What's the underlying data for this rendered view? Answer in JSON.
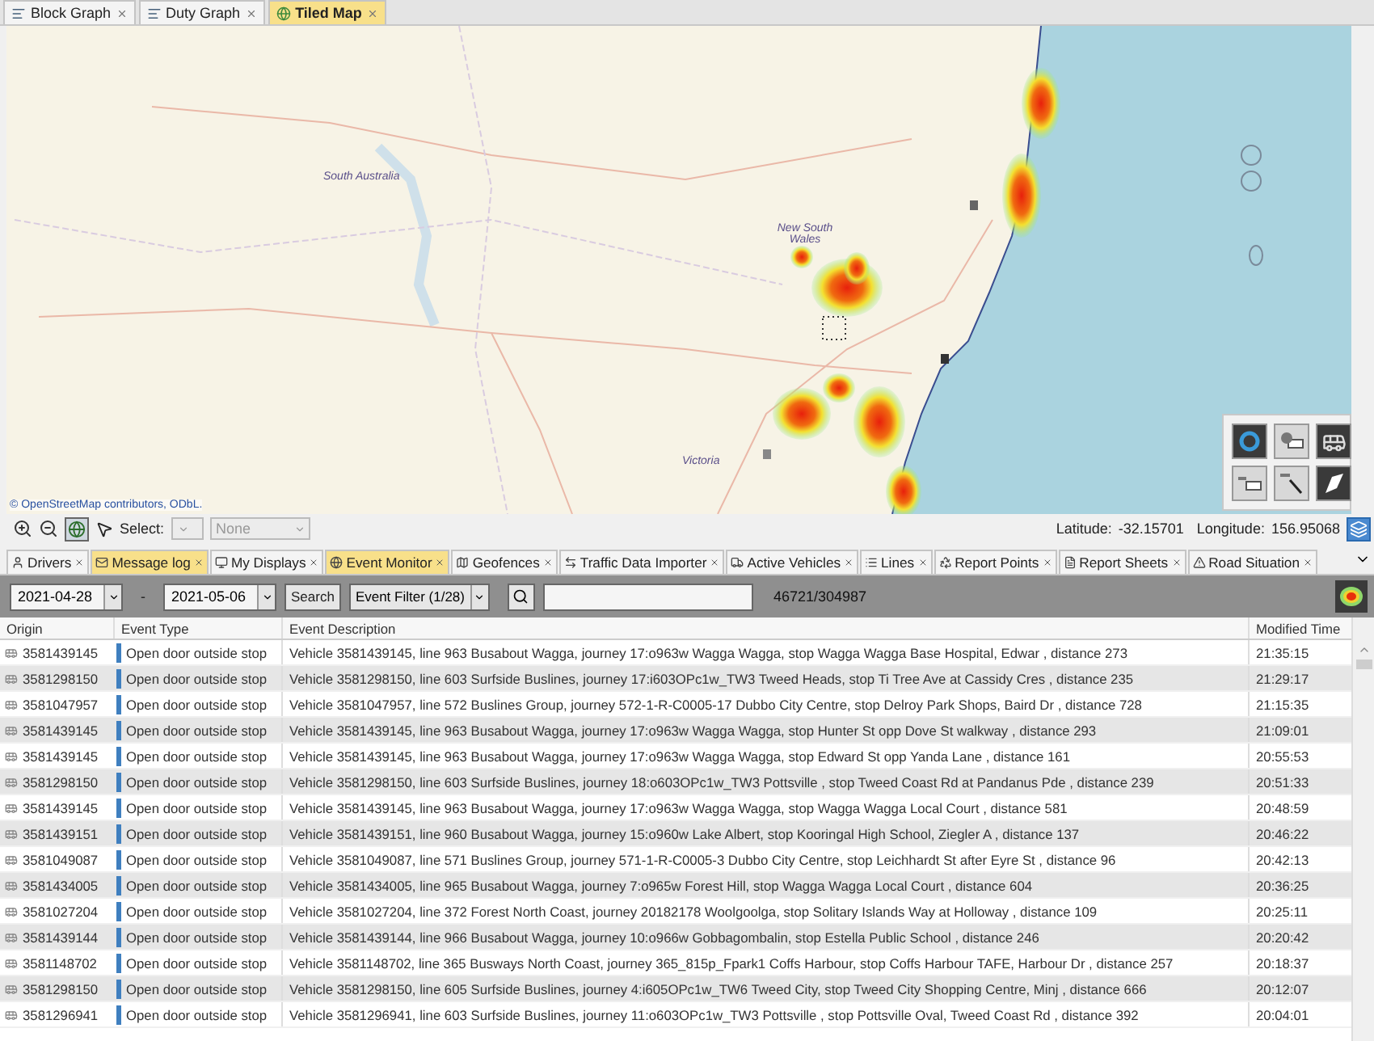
{
  "top_tabs": [
    {
      "label": "Block Graph",
      "selected": false
    },
    {
      "label": "Duty Graph",
      "selected": false
    },
    {
      "label": "Tiled Map",
      "selected": true
    }
  ],
  "map": {
    "labels": [
      "South Australia",
      "New South Wales",
      "Victoria"
    ],
    "attribution": "© OpenStreetMap contributors, ODbL.",
    "tools": [
      {
        "kind": "ring",
        "active": true
      },
      {
        "kind": "point",
        "active": false
      },
      {
        "kind": "bus",
        "active": true
      },
      {
        "kind": "box",
        "active": false
      },
      {
        "kind": "pen",
        "active": false
      },
      {
        "kind": "polygon",
        "active": true
      }
    ]
  },
  "map_toolbar": {
    "select_label": "Select:",
    "select_value": "None",
    "latitude_label": "Latitude:",
    "latitude": "-32.15701",
    "longitude_label": "Longitude:",
    "longitude": "156.95068"
  },
  "bottom_tabs": [
    {
      "label": "Drivers",
      "selected": false
    },
    {
      "label": "Message log",
      "selected": true
    },
    {
      "label": "My Displays",
      "selected": false
    },
    {
      "label": "Event Monitor",
      "selected": true
    },
    {
      "label": "Geofences",
      "selected": false
    },
    {
      "label": "Traffic Data Importer",
      "selected": false
    },
    {
      "label": "Active Vehicles",
      "selected": false
    },
    {
      "label": "Lines",
      "selected": false
    },
    {
      "label": "Report Points",
      "selected": false
    },
    {
      "label": "Report Sheets",
      "selected": false
    },
    {
      "label": "Road Situation",
      "selected": false
    }
  ],
  "filter_bar": {
    "date_from": "2021-04-28",
    "date_separator": "-",
    "date_to": "2021-05-06",
    "search_button": "Search",
    "event_filter": "Event Filter (1/28)",
    "count": "46721/304987"
  },
  "table": {
    "columns": [
      "Origin",
      "Event Type",
      "Event Description",
      "Modified Time"
    ],
    "rows": [
      {
        "origin": "3581439145",
        "event_type": "Open door outside stop",
        "description": "Vehicle 3581439145, line 963 Busabout Wagga, journey 17:o963w Wagga Wagga, stop Wagga Wagga Base Hospital, Edwar , distance 273",
        "time": "21:35:15"
      },
      {
        "origin": "3581298150",
        "event_type": "Open door outside stop",
        "description": "Vehicle 3581298150, line 603 Surfside Buslines, journey 17:i603OPc1w_TW3 Tweed Heads, stop Ti Tree Ave at Cassidy Cres , distance 235",
        "time": "21:29:17"
      },
      {
        "origin": "3581047957",
        "event_type": "Open door outside stop",
        "description": "Vehicle 3581047957, line 572 Buslines Group, journey 572-1-R-C0005-17 Dubbo City Centre, stop Delroy Park Shops, Baird Dr , distance 728",
        "time": "21:15:35"
      },
      {
        "origin": "3581439145",
        "event_type": "Open door outside stop",
        "description": "Vehicle 3581439145, line 963 Busabout Wagga, journey 17:o963w Wagga Wagga, stop Hunter St opp Dove St walkway , distance 293",
        "time": "21:09:01"
      },
      {
        "origin": "3581439145",
        "event_type": "Open door outside stop",
        "description": "Vehicle 3581439145, line 963 Busabout Wagga, journey 17:o963w Wagga Wagga, stop Edward St opp Yanda Lane , distance 161",
        "time": "20:55:53"
      },
      {
        "origin": "3581298150",
        "event_type": "Open door outside stop",
        "description": "Vehicle 3581298150, line 603 Surfside Buslines, journey 18:o603OPc1w_TW3 Pottsville , stop Tweed Coast Rd at Pandanus Pde , distance 239",
        "time": "20:51:33"
      },
      {
        "origin": "3581439145",
        "event_type": "Open door outside stop",
        "description": "Vehicle 3581439145, line 963 Busabout Wagga, journey 17:o963w Wagga Wagga, stop Wagga Wagga Local Court , distance 581",
        "time": "20:48:59"
      },
      {
        "origin": "3581439151",
        "event_type": "Open door outside stop",
        "description": "Vehicle 3581439151, line 960 Busabout Wagga, journey 15:o960w Lake Albert, stop Kooringal High School, Ziegler A , distance 137",
        "time": "20:46:22"
      },
      {
        "origin": "3581049087",
        "event_type": "Open door outside stop",
        "description": "Vehicle 3581049087, line 571 Buslines Group, journey 571-1-R-C0005-3 Dubbo City Centre, stop Leichhardt St after Eyre St , distance 96",
        "time": "20:42:13"
      },
      {
        "origin": "3581434005",
        "event_type": "Open door outside stop",
        "description": "Vehicle 3581434005, line 965 Busabout Wagga, journey 7:o965w Forest Hill, stop Wagga Wagga Local Court , distance 604",
        "time": "20:36:25"
      },
      {
        "origin": "3581027204",
        "event_type": "Open door outside stop",
        "description": "Vehicle 3581027204, line 372 Forest North Coast, journey 20182178 Woolgoolga, stop Solitary Islands Way at Holloway , distance 109",
        "time": "20:25:11"
      },
      {
        "origin": "3581439144",
        "event_type": "Open door outside stop",
        "description": "Vehicle 3581439144, line 966 Busabout Wagga, journey 10:o966w Gobbagombalin, stop Estella Public School , distance 246",
        "time": "20:20:42"
      },
      {
        "origin": "3581148702",
        "event_type": "Open door outside stop",
        "description": "Vehicle 3581148702, line 365 Busways North Coast, journey 365_815p_Fpark1 Coffs Harbour, stop Coffs Harbour TAFE, Harbour Dr , distance 257",
        "time": "20:18:37"
      },
      {
        "origin": "3581298150",
        "event_type": "Open door outside stop",
        "description": "Vehicle 3581298150, line 605 Surfside Buslines, journey 4:i605OPc1w_TW6 Tweed City, stop Tweed City Shopping Centre, Minj , distance 666",
        "time": "20:12:07"
      },
      {
        "origin": "3581296941",
        "event_type": "Open door outside stop",
        "description": "Vehicle 3581296941, line 603 Surfside Buslines, journey 11:o603OPc1w_TW3 Pottsville , stop Pottsville Oval, Tweed Coast Rd , distance 392",
        "time": "20:04:01"
      }
    ]
  }
}
